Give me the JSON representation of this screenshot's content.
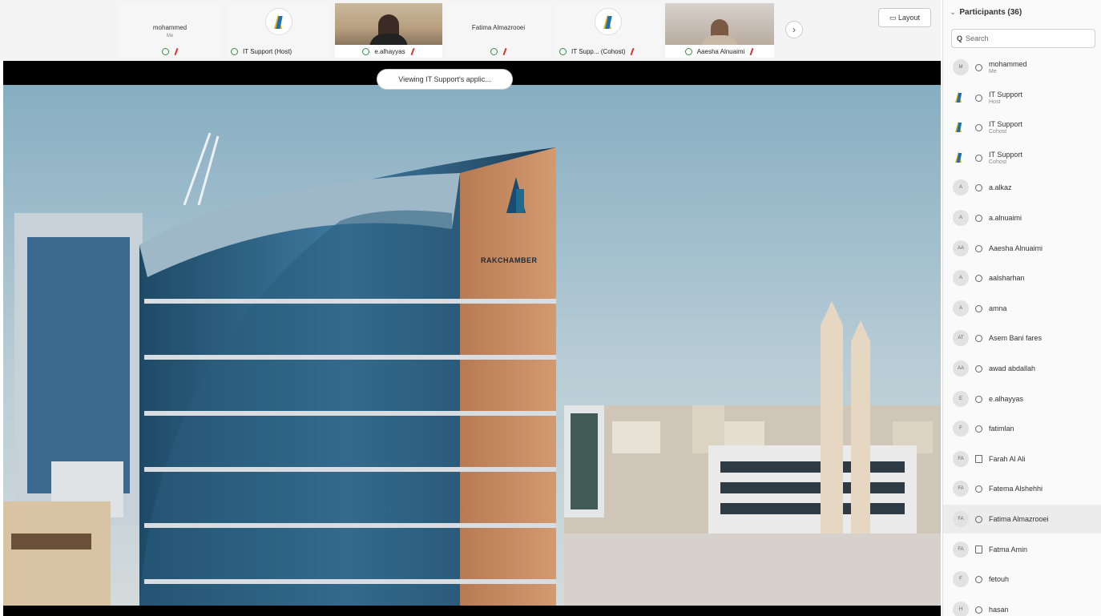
{
  "thumbnails": [
    {
      "name": "mohammed",
      "sub": "Me",
      "bar_label": ""
    },
    {
      "name": "",
      "sub": "",
      "bar_label": "IT Support (Host)"
    },
    {
      "name": "",
      "sub": "",
      "bar_label": "e.alhayyas"
    },
    {
      "name": "Fatima Almazrooei",
      "sub": "",
      "bar_label": ""
    },
    {
      "name": "",
      "sub": "",
      "bar_label": "IT Supp... (Cohost)"
    },
    {
      "name": "",
      "sub": "",
      "bar_label": "Aaesha Alnuaimi"
    }
  ],
  "toolbar": {
    "next_icon": "chevron-right-icon",
    "layout_label": "Layout"
  },
  "share": {
    "banner": "Viewing IT Support's applic...",
    "building_sign": "RAKCHAMBER"
  },
  "panel": {
    "title": "Participants (36)",
    "search_placeholder": "Search",
    "participants": [
      {
        "initials": "M",
        "name": "mohammed",
        "role": "Me",
        "type": "avatar",
        "status": "mic"
      },
      {
        "initials": "",
        "name": "IT Support",
        "role": "Host",
        "type": "logo",
        "status": "mic"
      },
      {
        "initials": "",
        "name": "IT Support",
        "role": "Cohost",
        "type": "logo",
        "status": "mic"
      },
      {
        "initials": "",
        "name": "IT Support",
        "role": "Cohost",
        "type": "logo",
        "status": "mic"
      },
      {
        "initials": "A",
        "name": "a.alkaz",
        "role": "",
        "type": "avatar",
        "status": "mic"
      },
      {
        "initials": "A",
        "name": "a.alnuaimi",
        "role": "",
        "type": "avatar",
        "status": "mic"
      },
      {
        "initials": "AA",
        "name": "Aaesha Alnuaimi",
        "role": "",
        "type": "avatar",
        "status": "mic"
      },
      {
        "initials": "A",
        "name": "aalsharhan",
        "role": "",
        "type": "avatar",
        "status": "mic"
      },
      {
        "initials": "A",
        "name": "amna",
        "role": "",
        "type": "avatar",
        "status": "mic"
      },
      {
        "initials": "AT",
        "name": "Asem Bani fares",
        "role": "",
        "type": "avatar",
        "status": "mic"
      },
      {
        "initials": "AA",
        "name": "awad abdallah",
        "role": "",
        "type": "avatar",
        "status": "mic"
      },
      {
        "initials": "E",
        "name": "e.alhayyas",
        "role": "",
        "type": "avatar",
        "status": "mic"
      },
      {
        "initials": "F",
        "name": "fatimlan",
        "role": "",
        "type": "avatar",
        "status": "mic"
      },
      {
        "initials": "FA",
        "name": "Farah Al Ali",
        "role": "",
        "type": "avatar",
        "status": "device"
      },
      {
        "initials": "FA",
        "name": "Fatema Alshehhi",
        "role": "",
        "type": "avatar",
        "status": "mic"
      },
      {
        "initials": "FA",
        "name": "Fatima Almazrooei",
        "role": "",
        "type": "avatar",
        "status": "mic"
      },
      {
        "initials": "FA",
        "name": "Fatma Amin",
        "role": "",
        "type": "avatar",
        "status": "device"
      },
      {
        "initials": "F",
        "name": "fetouh",
        "role": "",
        "type": "avatar",
        "status": "mic"
      },
      {
        "initials": "H",
        "name": "hasan",
        "role": "",
        "type": "avatar",
        "status": "mic"
      }
    ]
  },
  "colors": {
    "accent": "#1f6fb5",
    "logo_gold": "#e2b10c",
    "mic_green": "#3a8a4e",
    "muted_red": "#dd3333"
  }
}
